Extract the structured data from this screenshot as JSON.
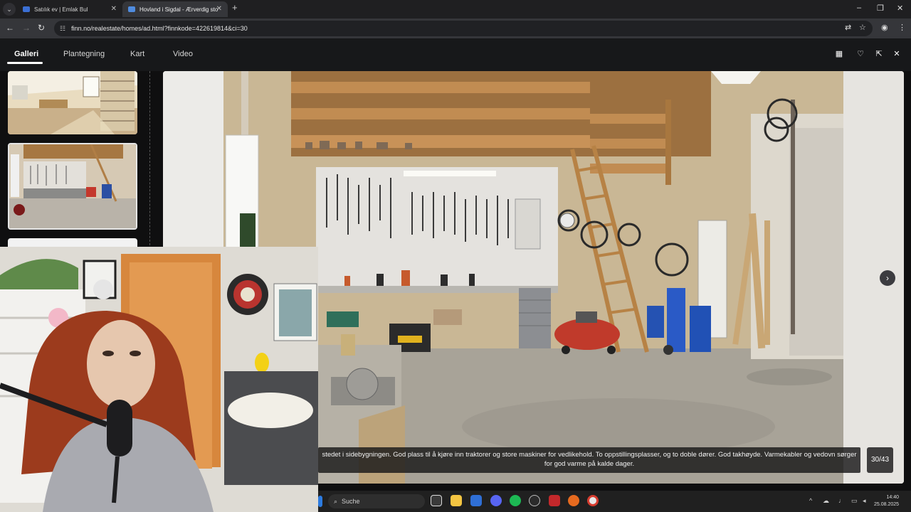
{
  "browser": {
    "tabs": [
      {
        "title": "Satılık ev | Emlak Bul",
        "active": false
      },
      {
        "title": "Hovland i Sigdal - Ærverdig sto",
        "active": true
      }
    ],
    "url": "finn.no/realestate/homes/ad.html?finnkode=422619814&ci=30",
    "icons": {
      "tab_list": "chevron-down-icon",
      "new_tab": "plus-icon",
      "back": "back-arrow-icon",
      "forward": "forward-arrow-icon",
      "reload": "reload-icon",
      "site_info": "tune-icon",
      "translate": "translate-icon",
      "bookmark": "star-icon",
      "profile": "profile-icon",
      "menu": "kebab-menu-icon"
    }
  },
  "viewer": {
    "tabs": [
      {
        "label": "Galleri",
        "active": true
      },
      {
        "label": "Plantegning",
        "active": false
      },
      {
        "label": "Kart",
        "active": false
      },
      {
        "label": "Video",
        "active": false
      }
    ],
    "icons": {
      "calendar": "calendar-icon",
      "favorite": "heart-icon",
      "share": "share-icon",
      "close": "close-icon",
      "next": "chevron-right-icon"
    }
  },
  "gallery": {
    "caption": "stedet i sidebygningen. God plass til å kjøre inn traktorer og store maskiner for vedlikehold. To oppstillingsplasser, og to doble dører. God takhøyde. Varmekabler og vedovn sørger for god varme på kalde dager.",
    "current": 30,
    "total": 43,
    "counter_text": "30/43"
  },
  "taskbar": {
    "search_placeholder": "Suche",
    "time": "14:40",
    "date": "25.08.2025",
    "apps": [
      "task-view-icon",
      "file-explorer-icon",
      "store-icon",
      "discord-icon",
      "spotify-icon",
      "obs-icon",
      "video-app-icon",
      "firefox-icon",
      "chrome-icon"
    ]
  },
  "colors": {
    "accent": "#ffffff",
    "background": "#0f0f10",
    "tab_active": "#35363a"
  }
}
